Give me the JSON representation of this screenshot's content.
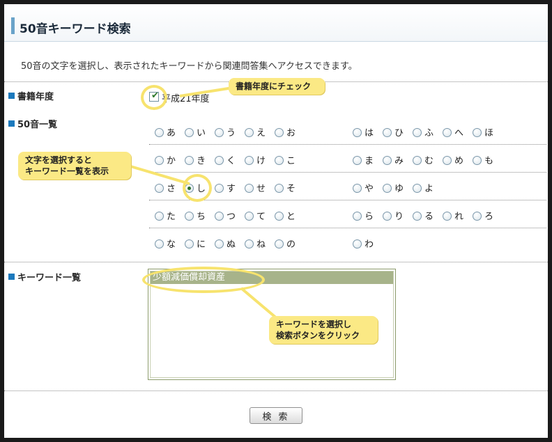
{
  "header": {
    "title": "50音キーワード検索"
  },
  "description": "50音の文字を選択し、表示されたキーワードから関連問答集へアクセスできます。",
  "sections": {
    "year": {
      "label": "書籍年度",
      "checkbox_label": "平成21年度",
      "checked": true
    },
    "kana": {
      "label": "50音一覧"
    },
    "keywords": {
      "label": "キーワード一覧"
    }
  },
  "kana_rows": [
    [
      "あ",
      "い",
      "う",
      "え",
      "お",
      "は",
      "ひ",
      "ふ",
      "へ",
      "ほ"
    ],
    [
      "か",
      "き",
      "く",
      "け",
      "こ",
      "ま",
      "み",
      "む",
      "め",
      "も"
    ],
    [
      "さ",
      "し",
      "す",
      "せ",
      "そ",
      "や",
      "ゆ",
      "よ"
    ],
    [
      "た",
      "ち",
      "つ",
      "て",
      "と",
      "ら",
      "り",
      "る",
      "れ",
      "ろ"
    ],
    [
      "な",
      "に",
      "ぬ",
      "ね",
      "の",
      "わ"
    ]
  ],
  "selected_kana": "し",
  "keyword_list": {
    "items": [
      "少額減価償却資産"
    ],
    "selected": "少額減価償却資産"
  },
  "search_button_label": "検 索",
  "callouts": {
    "year": "書籍年度にチェック",
    "kana": [
      "文字を選択すると",
      "キーワード一覧を表示"
    ],
    "keyword": [
      "キーワードを選択し",
      "検索ボタンをクリック"
    ]
  },
  "colors": {
    "accent": "#1b79bd",
    "callout": "#fbe985",
    "selection": "#a7b38a"
  }
}
